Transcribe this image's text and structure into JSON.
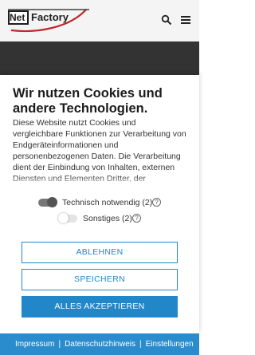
{
  "header": {
    "logo_net": "Net",
    "logo_factory": "Factory"
  },
  "cookie_dialog": {
    "title": "Wir nutzen Cookies und andere Technologien.",
    "body": "Diese Website nutzt Cookies und vergleichbare Funktionen zur Verarbeitung von Endgeräteinformationen und personenbezogenen Daten. Die Verarbeitung dient der Einbindung von Inhalten, externen Diensten und Elementen Dritter, der",
    "options": [
      {
        "label": "Technisch notwendig (2)",
        "enabled": true
      },
      {
        "label": "Sonstiges (2)",
        "enabled": false
      }
    ],
    "help_glyph": "?",
    "buttons": {
      "reject": "ABLEHNEN",
      "save": "SPEICHERN",
      "accept_all": "ALLES AKZEPTIEREN"
    }
  },
  "footer": {
    "links": [
      "Impressum",
      "Datenschutzhinweis",
      "Einstellungen"
    ],
    "separator": "|"
  },
  "colors": {
    "accent": "#2287c9",
    "footer_bg": "#2a8ccd",
    "hero_bg": "#333333"
  },
  "icons": {
    "search": "search-icon",
    "menu": "menu-icon"
  }
}
